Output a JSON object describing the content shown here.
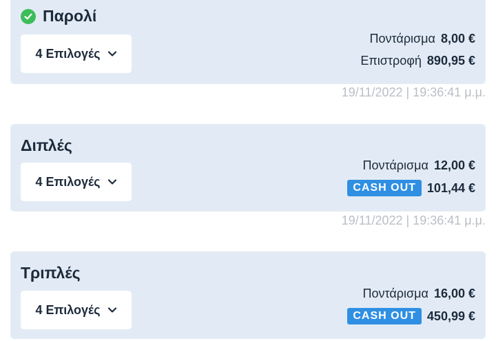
{
  "bets": [
    {
      "title": "Παρολί",
      "show_check": true,
      "selections_label": "4 Επιλογές",
      "line1_label": "Ποντάρισμα",
      "line1_value": "8,00 €",
      "line2_label": "Επιστροφή",
      "line2_value": "890,95 €",
      "timestamp": "19/11/2022 | 19:36:41 μ.μ."
    },
    {
      "title": "Διπλές",
      "selections_label": "4 Επιλογές",
      "line1_label": "Ποντάρισμα",
      "line1_value": "12,00 €",
      "cashout_label": "CASH OUT",
      "line2_value": "101,44 €",
      "timestamp": "19/11/2022 | 19:36:41 μ.μ."
    },
    {
      "title": "Τριπλές",
      "selections_label": "4 Επιλογές",
      "line1_label": "Ποντάρισμα",
      "line1_value": "16,00 €",
      "cashout_label": "CASH OUT",
      "line2_value": "450,99 €"
    }
  ],
  "icons": {
    "status": "check-circle-icon",
    "dropdown": "chevron-down-icon"
  },
  "colors": {
    "card_bg": "#e2ebf5",
    "success": "#3dbd5a",
    "cashout": "#2f8fe3",
    "timestamp": "#b9bfc6"
  }
}
